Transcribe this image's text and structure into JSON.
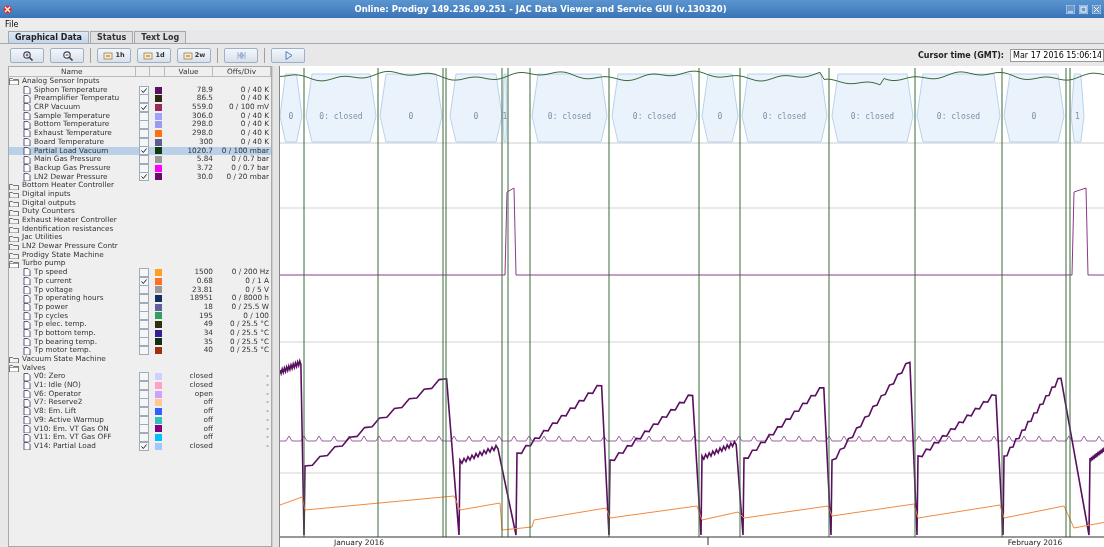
{
  "window": {
    "title": "Online: Prodigy 149.236.99.251 - JAC Data Viewer and Service GUI (v.130320)"
  },
  "menu": [
    "File"
  ],
  "tabs": [
    {
      "label": "Graphical Data",
      "selected": true
    },
    {
      "label": "Status",
      "selected": false
    },
    {
      "label": "Text Log",
      "selected": false
    }
  ],
  "toolbar": [
    {
      "kind": "zoom-in"
    },
    {
      "kind": "zoom-out"
    },
    {
      "kind": "range",
      "label": "1h"
    },
    {
      "kind": "range",
      "label": "1d"
    },
    {
      "kind": "range",
      "label": "2w"
    },
    {
      "kind": "skip"
    },
    {
      "kind": "play"
    }
  ],
  "cursor_time": {
    "label": "Cursor time (GMT):",
    "value": "Mar 17 2016 15:06:14"
  },
  "table": {
    "columns": [
      "Name",
      "Value",
      "Offs/Div"
    ],
    "groups": [
      {
        "name": "Analog Sensor Inputs",
        "expanded": true,
        "children": [
          {
            "name": "Siphon Temperature",
            "checked": true,
            "color": "#5c1060",
            "value": "78.9",
            "offs_div": "0 / 40 K",
            "selected": false
          },
          {
            "name": "Preamplifier Temperatu",
            "checked": false,
            "color": "#2b2b10",
            "value": "86.5",
            "offs_div": "0 / 40 K",
            "selected": false
          },
          {
            "name": "CRP Vacuum",
            "checked": true,
            "color": "#9b2a5a",
            "value": "559.0",
            "offs_div": "0 / 100 mV",
            "selected": false
          },
          {
            "name": "Sample Temperature",
            "checked": false,
            "color": "#a0a0ff",
            "value": "306.0",
            "offs_div": "0 / 40 K",
            "selected": false
          },
          {
            "name": "Bottom Temperature",
            "checked": false,
            "color": "#9a9af5",
            "value": "298.0",
            "offs_div": "0 / 40 K",
            "selected": false
          },
          {
            "name": "Exhaust Temperature",
            "checked": false,
            "color": "#ff7010",
            "value": "298.0",
            "offs_div": "0 / 40 K",
            "selected": false
          },
          {
            "name": "Board Temperature",
            "checked": false,
            "color": "#5a6090",
            "value": "300",
            "offs_div": "0 / 40 K",
            "selected": false
          },
          {
            "name": "Partial Load Vacuum",
            "checked": true,
            "color": "#0d3a10",
            "value": "1020.7",
            "offs_div": "0 / 100 mbar",
            "selected": true
          },
          {
            "name": "Main Gas Pressure",
            "checked": false,
            "color": "#999999",
            "value": "5.84",
            "offs_div": "0 / 0.7 bar",
            "selected": false
          },
          {
            "name": "Backup Gas Pressure",
            "checked": false,
            "color": "#ff00ff",
            "value": "3.72",
            "offs_div": "0 / 0.7 bar",
            "selected": false
          },
          {
            "name": "LN2 Dewar Pressure",
            "checked": true,
            "color": "#6a0a6a",
            "value": "30.0",
            "offs_div": "0 / 20 mbar",
            "selected": false
          }
        ]
      },
      {
        "name": "Bottom Heater Controller",
        "expanded": false
      },
      {
        "name": "Digital inputs",
        "expanded": false
      },
      {
        "name": "Digital outputs",
        "expanded": false
      },
      {
        "name": "Duty Counters",
        "expanded": false
      },
      {
        "name": "Exhaust Heater Controller",
        "expanded": false
      },
      {
        "name": "Identification resistances",
        "expanded": false
      },
      {
        "name": "Jac Utilities",
        "expanded": false
      },
      {
        "name": "LN2 Dewar Pressure Contr",
        "expanded": false
      },
      {
        "name": "Prodigy State Machine",
        "expanded": false
      },
      {
        "name": "Turbo pump",
        "expanded": true,
        "children": [
          {
            "name": "Tp speed",
            "checked": false,
            "color": "#ffa020",
            "value": "1500",
            "offs_div": "0 / 200 Hz",
            "selected": false
          },
          {
            "name": "Tp current",
            "checked": true,
            "color": "#ff7020",
            "value": "0.68",
            "offs_div": "0 / 1 A",
            "selected": false
          },
          {
            "name": "Tp voltage",
            "checked": false,
            "color": "#999998",
            "value": "23.81",
            "offs_div": "0 / 5 V",
            "selected": false
          },
          {
            "name": "Tp operating hours",
            "checked": false,
            "color": "#103060",
            "value": "18951",
            "offs_div": "0 / 8000 h",
            "selected": false
          },
          {
            "name": "Tp power",
            "checked": false,
            "color": "#6060a0",
            "value": "18",
            "offs_div": "0 / 25.5 W",
            "selected": false
          },
          {
            "name": "Tp cycles",
            "checked": false,
            "color": "#30a060",
            "value": "195",
            "offs_div": "0 / 100",
            "selected": false
          },
          {
            "name": "Tp elec. temp.",
            "checked": false,
            "color": "#303010",
            "value": "49",
            "offs_div": "0 / 25.5 °C",
            "selected": false
          },
          {
            "name": "Tp bottom temp.",
            "checked": false,
            "color": "#302090",
            "value": "34",
            "offs_div": "0 / 25.5 °C",
            "selected": false
          },
          {
            "name": "Tp bearing temp.",
            "checked": false,
            "color": "#103010",
            "value": "35",
            "offs_div": "0 / 25.5 °C",
            "selected": false
          },
          {
            "name": "Tp motor temp.",
            "checked": false,
            "color": "#a03010",
            "value": "40",
            "offs_div": "0 / 25.5 °C",
            "selected": false
          }
        ]
      },
      {
        "name": "Vacuum State Machine",
        "expanded": false
      },
      {
        "name": "Valves",
        "expanded": true,
        "children": [
          {
            "name": "V0: Zero",
            "checked": false,
            "color": "#d0d0ff",
            "value": "closed",
            "offs_div": "-",
            "selected": false
          },
          {
            "name": "V1: Idle (NO)",
            "checked": false,
            "color": "#ffa0c8",
            "value": "closed",
            "offs_div": "-",
            "selected": false
          },
          {
            "name": "V6: Operator",
            "checked": false,
            "color": "#d0a0ff",
            "value": "open",
            "offs_div": "-",
            "selected": false
          },
          {
            "name": "V7: Reserve2",
            "checked": false,
            "color": "#ffc890",
            "value": "off",
            "offs_div": "-",
            "selected": false
          },
          {
            "name": "V8: Em. Lift",
            "checked": false,
            "color": "#3060ff",
            "value": "off",
            "offs_div": "-",
            "selected": false
          },
          {
            "name": "V9: Active Warmup",
            "checked": false,
            "color": "#30c0c0",
            "value": "off",
            "offs_div": "-",
            "selected": false
          },
          {
            "name": "V10: Em. VT Gas ON",
            "checked": false,
            "color": "#800080",
            "value": "off",
            "offs_div": "-",
            "selected": false
          },
          {
            "name": "V11: Em. VT Gas OFF",
            "checked": false,
            "color": "#00c0ff",
            "value": "off",
            "offs_div": "-",
            "selected": false
          },
          {
            "name": "V14: Partial Load",
            "checked": true,
            "color": "#a0c8ff",
            "value": "closed",
            "offs_div": "-",
            "selected": false
          }
        ]
      }
    ]
  },
  "valve_bands": [
    {
      "label": "0"
    },
    {
      "label": "0: closed"
    },
    {
      "label": "0"
    },
    {
      "label": "0"
    },
    {
      "label": "1"
    },
    {
      "label": "0: closed"
    },
    {
      "label": "0: closed"
    },
    {
      "label": "0"
    },
    {
      "label": "0: closed"
    },
    {
      "label": "0: closed"
    },
    {
      "label": "0: closed"
    },
    {
      "label": "0"
    },
    {
      "label": "1"
    }
  ],
  "time_axis": {
    "labels": [
      "January 2016",
      "February 2016"
    ]
  }
}
